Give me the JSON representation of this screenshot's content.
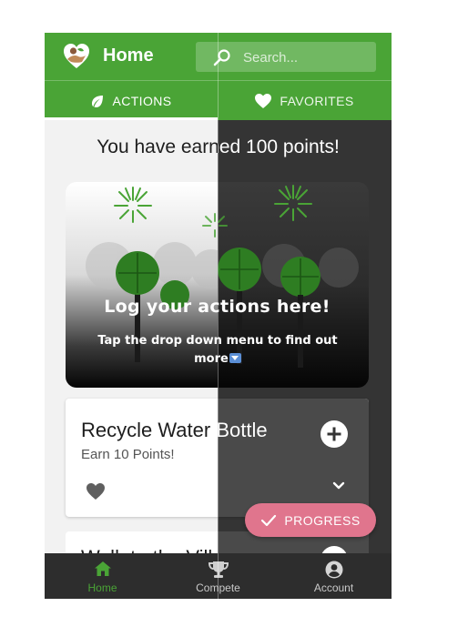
{
  "header": {
    "title": "Home",
    "search_placeholder": "Search..."
  },
  "tabs": [
    {
      "label": "ACTIONS",
      "icon": "leaf-icon",
      "active": true
    },
    {
      "label": "FAVORITES",
      "icon": "heart-icon",
      "active": false
    }
  ],
  "points_message": "You have earned 100 points!",
  "banner": {
    "title": "Log your actions here!",
    "subtitle": "Tap the drop down menu to find out more"
  },
  "action_cards": [
    {
      "title": "Recycle Water Bottle",
      "subtitle": "Earn 10 Points!"
    },
    {
      "title": "Walk to the Villa"
    }
  ],
  "fab": {
    "label": "PROGRESS",
    "icon": "check-icon",
    "color": "#e0758d"
  },
  "bottom_nav": [
    {
      "label": "Home",
      "icon": "home-icon",
      "active": true
    },
    {
      "label": "Compete",
      "icon": "trophy-icon",
      "active": false
    },
    {
      "label": "Account",
      "icon": "account-icon",
      "active": false
    }
  ],
  "colors": {
    "brand_green": "#4aa436",
    "dark_theme_bg": "#343434",
    "light_theme_bg": "#f2f2f2"
  }
}
